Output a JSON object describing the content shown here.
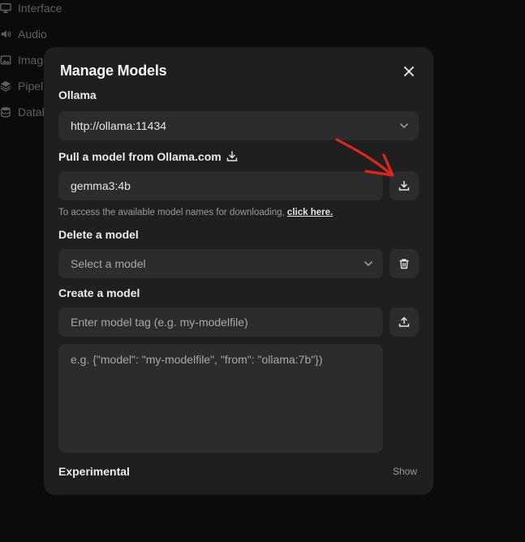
{
  "background_nav": {
    "items": [
      {
        "label": "Interface",
        "icon": "monitor-icon"
      },
      {
        "label": "Audio",
        "icon": "speaker-icon"
      },
      {
        "label": "Images",
        "icon": "image-icon"
      },
      {
        "label": "Pipelines",
        "icon": "layers-icon"
      },
      {
        "label": "Database",
        "icon": "database-icon"
      }
    ]
  },
  "modal": {
    "title": "Manage Models",
    "ollama_label": "Ollama",
    "ollama_url": "http://ollama:11434",
    "pull": {
      "label": "Pull a model from Ollama.com",
      "value": "gemma3:4b",
      "hint": "To access the available model names for downloading,",
      "hint_link": "click here."
    },
    "delete": {
      "label": "Delete a model",
      "placeholder": "Select a model"
    },
    "create": {
      "label": "Create a model",
      "tag_placeholder": "Enter model tag (e.g. my-modelfile)",
      "content_placeholder": "e.g. {\"model\": \"my-modelfile\", \"from\": \"ollama:7b\"})"
    },
    "experimental_label": "Experimental",
    "show_label": "Show"
  },
  "colors": {
    "page_bg": "#0b0b0b",
    "modal_bg": "#1f1f1f",
    "field_bg": "#2c2c2c",
    "annotation": "#e0251b"
  }
}
